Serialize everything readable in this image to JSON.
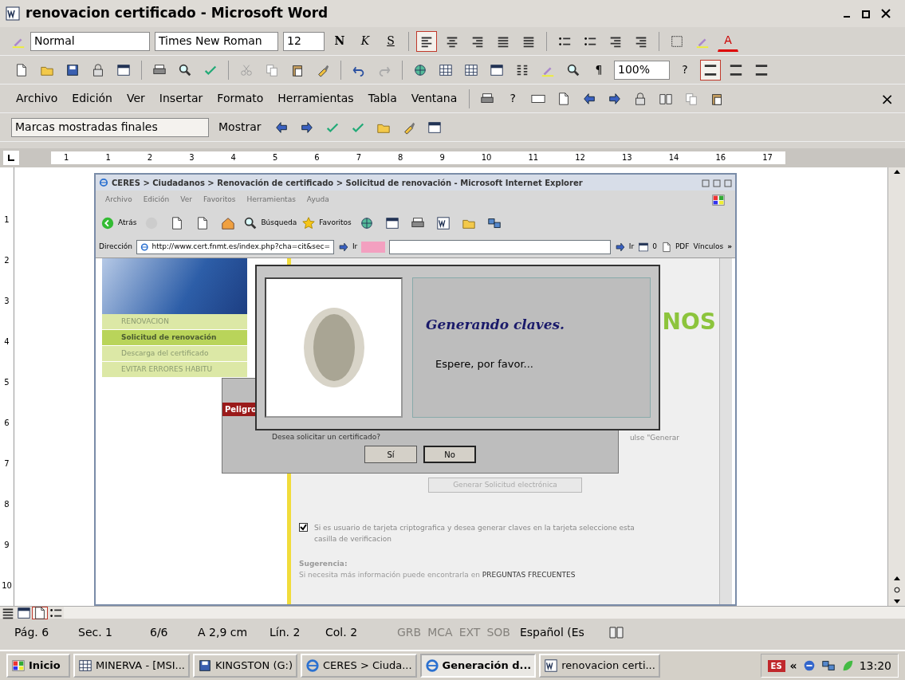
{
  "window": {
    "title": "renovacion certificado - Microsoft Word"
  },
  "formatting_toolbar": {
    "style": "Normal",
    "font": "Times New Roman",
    "size": "12",
    "bold": "N",
    "italic": "K",
    "underline": "S",
    "font_color": "A",
    "alignment": [
      {
        "selected": true
      },
      {
        "selected": false
      },
      {
        "selected": false
      },
      {
        "selected": false
      }
    ]
  },
  "standard_toolbar": {
    "pilcrow": "¶",
    "zoom": "100%",
    "help": "?"
  },
  "menu": [
    {
      "label": "Archivo"
    },
    {
      "label": "Edición"
    },
    {
      "label": "Ver"
    },
    {
      "label": "Insertar"
    },
    {
      "label": "Formato"
    },
    {
      "label": "Herramientas"
    },
    {
      "label": "Tabla"
    },
    {
      "label": "Ventana"
    }
  ],
  "menu_help": "?",
  "menu_close": "×",
  "reviewing_toolbar": {
    "display": "Marcas mostradas finales",
    "show": "Mostrar"
  },
  "ruler": {
    "labels": [
      "1",
      "1",
      "2",
      "3",
      "4",
      "5",
      "6",
      "7",
      "8",
      "9",
      "10",
      "11",
      "12",
      "13",
      "14",
      "16",
      "17"
    ],
    "vertical_labels": [
      "1",
      "2",
      "3",
      "4",
      "5",
      "6",
      "7",
      "8",
      "9",
      "10"
    ]
  },
  "embedded_browser": {
    "title": "CERES > Ciudadanos > Renovación de certificado > Solicitud de renovación - Microsoft Internet Explorer",
    "menu": [
      {
        "label": "Archivo",
        "disabled": true
      },
      {
        "label": "Edición",
        "disabled": true
      },
      {
        "label": "Ver",
        "disabled": true
      },
      {
        "label": "Favoritos",
        "disabled": true
      },
      {
        "label": "Herramientas",
        "disabled": true
      },
      {
        "label": "Ayuda",
        "disabled": true
      }
    ],
    "back": "Atrás",
    "search": "Búsqueda",
    "favorites": "Favoritos",
    "address_label": "Dirección",
    "url": "http://www.cert.fnmt.es/index.php?cha=cit&sec=",
    "go": "Ir",
    "go2": "Ir",
    "count": "0",
    "pdf": "PDF",
    "links": "Vínculos",
    "more": "»",
    "sidebar": [
      {
        "label": "RENOVACION",
        "selected": false
      },
      {
        "label": "Solicitud de renovación",
        "selected": true
      },
      {
        "label": "Descarga del certificado",
        "selected": false
      },
      {
        "label": "EVITAR ERRORES HABITU",
        "selected": false
      }
    ],
    "heading": "NOS",
    "instruction": "ulse \"Generar",
    "generate_button": {
      "label": "Generar Solicitud electrónica",
      "disabled": true
    },
    "card_option": {
      "label": "Si es usuario de tarjeta criptografica y desea generar claves en la tarjeta seleccione esta casilla de verificacion",
      "checked": true
    },
    "hint_title": "Sugerencia:",
    "hint_text": "Si necesita más información puede encontrarla en ",
    "hint_link": "PREGUNTAS FRECUENTES",
    "danger_dialog": {
      "title": "Peligro",
      "question": "Desea solicitar un certificado?",
      "buttons": [
        {
          "label": "Sí",
          "selected": false
        },
        {
          "label": "No",
          "selected": true
        }
      ]
    },
    "progress_window": {
      "title": "Generando claves.",
      "message": "Espere, por favor..."
    }
  },
  "view_buttons": [
    {
      "selected": false
    },
    {
      "selected": false
    },
    {
      "selected": true
    },
    {
      "selected": false
    }
  ],
  "status_bar": {
    "fields": [
      "Pág. 6",
      "Sec. 1",
      "6/6",
      "A 2,9 cm",
      "Lín. 2",
      "Col. 2"
    ],
    "indicators": [
      {
        "label": "GRB",
        "disabled": true
      },
      {
        "label": "MCA",
        "disabled": true
      },
      {
        "label": "EXT",
        "disabled": true
      },
      {
        "label": "SOB",
        "disabled": true
      }
    ],
    "language": "Español (Es"
  },
  "taskbar": {
    "start": "Inicio",
    "tasks": [
      {
        "label": "MINERVA - [MSI...",
        "selected": false
      },
      {
        "label": "KINGSTON (G:)",
        "selected": false
      },
      {
        "label": "CERES > Ciuda...",
        "selected": false
      },
      {
        "label": "Generación d...",
        "selected": true
      },
      {
        "label": "renovacion certi...",
        "selected": false
      }
    ],
    "language": "ES",
    "expand": "«",
    "clock": "13:20"
  }
}
